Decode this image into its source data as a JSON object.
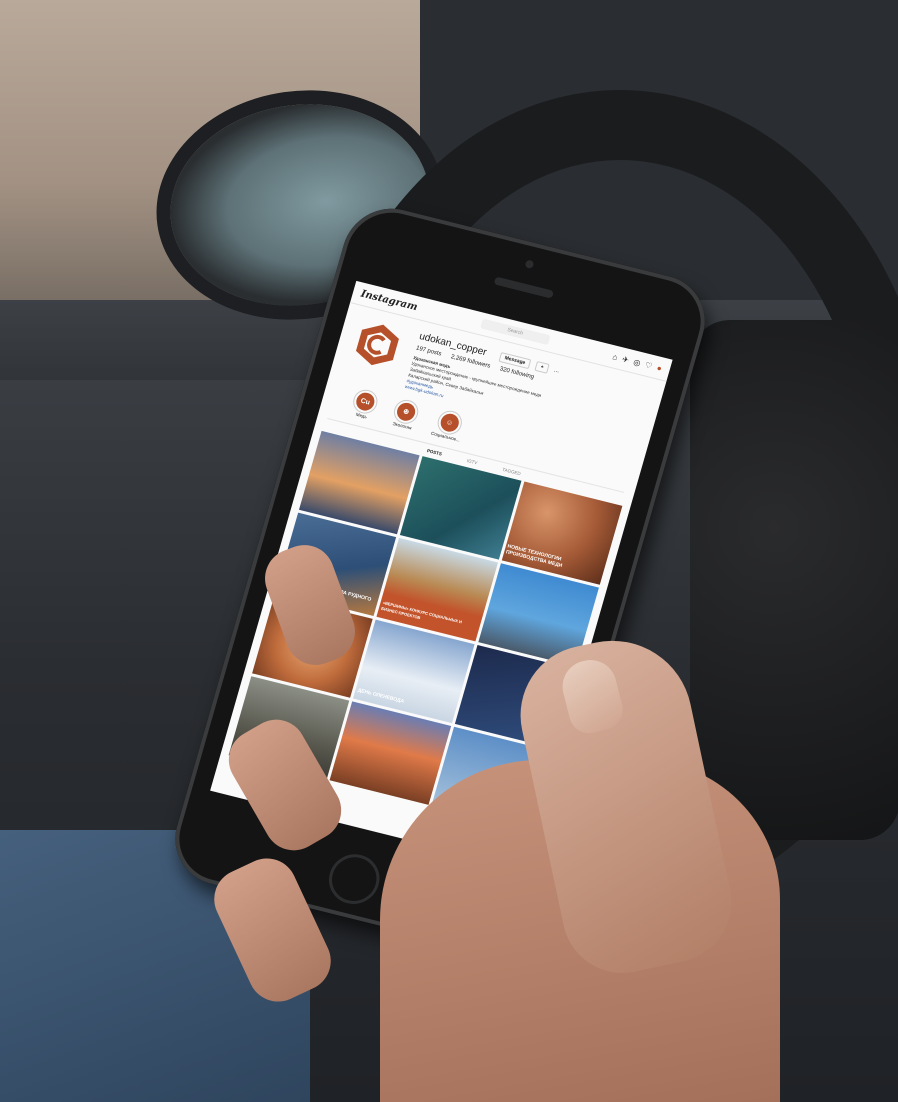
{
  "instagram": {
    "logo": "Instagram",
    "search_placeholder": "Search",
    "username": "udokan_copper",
    "buttons": {
      "message": "Message",
      "follow": "+",
      "more": "..."
    },
    "stats": {
      "posts": "197 posts",
      "followers": "2,269 followers",
      "following": "320 following"
    },
    "bio": {
      "title": "Удоканская медь",
      "line1": "Удоканское месторождение - крупнейшее месторождение меди",
      "line2": "Забайкальский край",
      "line3": "Каларский район, Север Забайкалья",
      "line4": "#удоканмедь",
      "link": "www.bgk-udokan.ru"
    },
    "highlights": [
      {
        "label": "Медь",
        "icon": "Cu"
      },
      {
        "label": "Экология",
        "icon": "⊕"
      },
      {
        "label": "Социальное...",
        "icon": "☺"
      }
    ],
    "tabs": [
      "POSTS",
      "IGTV",
      "TAGGED"
    ],
    "tiles": [
      {
        "caption": ""
      },
      {
        "caption": ""
      },
      {
        "caption": "НОВЫЕ ТЕХНОЛОГИИ ПРОИЗВОДСТВА МЕДИ"
      },
      {
        "caption": "НАЧАЛО СТРОИТЕЛЬСТВА РУДНОГО СКЛАДА"
      },
      {
        "caption": "«ВЕРШИНЫ» КОНКУРС СОЦИАЛЬНЫХ И БИЗНЕС-ПРОЕКТОВ"
      },
      {
        "caption": ""
      },
      {
        "caption": ""
      },
      {
        "caption": "ДЕНЬ ОЛЕНЕВОДА"
      },
      {
        "caption": ""
      },
      {
        "caption": ""
      },
      {
        "caption": ""
      },
      {
        "caption": ""
      }
    ]
  },
  "colors": {
    "brand": "#b5502a",
    "screen_bg": "#fafafa"
  }
}
